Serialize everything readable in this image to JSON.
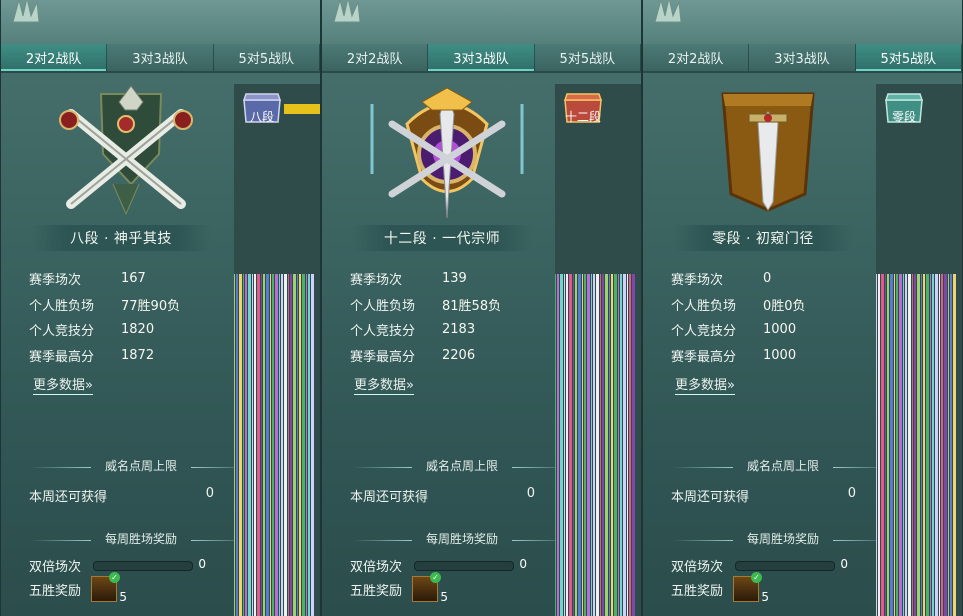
{
  "tabs": [
    "2对2战队",
    "3对3战队",
    "5对5战队"
  ],
  "labels": {
    "season_games": "赛季场次",
    "win_loss": "个人胜负场",
    "rating": "个人竞技分",
    "season_high": "赛季最高分",
    "more_data": "更多数据",
    "fame_title": "威名点周上限",
    "weekly_available": "本周还可获得",
    "weekly_reward_title": "每周胜场奖励",
    "double_games": "双倍场次",
    "five_win_reward": "五胜奖励"
  },
  "panels": [
    {
      "active_tab": 0,
      "rank_title": "八段 · 神乎其技",
      "badge_label": "八段",
      "stats": {
        "season_games": "167",
        "win_loss": "77胜90负",
        "rating": "1820",
        "season_high": "1872"
      },
      "weekly_available": "0",
      "double_games_value": "0",
      "reward_count": "5",
      "colors": {
        "accent": "#b8a8ff",
        "badge": "#5a6aa8"
      }
    },
    {
      "active_tab": 1,
      "rank_title": "十二段 · 一代宗师",
      "badge_label": "十二段",
      "stats": {
        "season_games": "139",
        "win_loss": "81胜58负",
        "rating": "2183",
        "season_high": "2206"
      },
      "weekly_available": "0",
      "double_games_value": "0",
      "reward_count": "5",
      "colors": {
        "accent": "#ffcf5a",
        "badge": "#b94a3c"
      }
    },
    {
      "active_tab": 2,
      "rank_title": "零段 · 初窥门径",
      "badge_label": "零段",
      "stats": {
        "season_games": "0",
        "win_loss": "0胜0负",
        "rating": "1000",
        "season_high": "1000"
      },
      "weekly_available": "0",
      "double_games_value": "0",
      "reward_count": "5",
      "colors": {
        "accent": "#ffffff",
        "badge": "#3f8f84"
      }
    }
  ],
  "icons": {
    "emblem_8": "crossed-swords-crown-emblem",
    "emblem_12": "golden-sword-shield-emblem",
    "emblem_0": "sword-banner-emblem",
    "reward": "treasure-chest-icon",
    "check": "check-icon"
  }
}
